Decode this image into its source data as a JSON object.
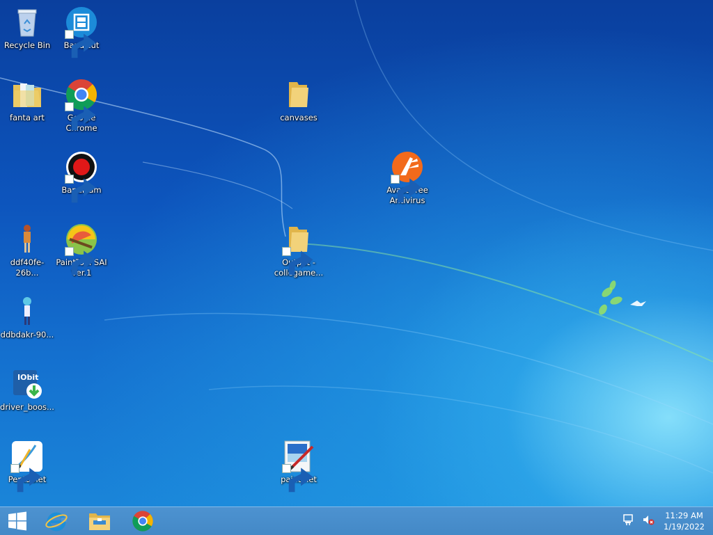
{
  "desktop": {
    "icons": [
      {
        "label": "Recycle Bin",
        "icon": "recycle-bin-icon",
        "shortcut": false
      },
      {
        "label": "Bandicut",
        "icon": "bandicut-icon",
        "shortcut": true
      },
      {
        "label": "fanta art",
        "icon": "folder-icon",
        "shortcut": false
      },
      {
        "label": "Google Chrome",
        "icon": "chrome-icon",
        "shortcut": true
      },
      {
        "label": "canvases",
        "icon": "folder-icon",
        "shortcut": false
      },
      {
        "label": "Bandicam",
        "icon": "bandicam-icon",
        "shortcut": true
      },
      {
        "label": "Avast Free Antivirus",
        "icon": "avast-icon",
        "shortcut": true
      },
      {
        "label": "ddf40fe-26b...",
        "icon": "image-file-icon",
        "shortcut": false
      },
      {
        "label": "PaintTool SAI Ver.1",
        "icon": "painttool-sai-icon",
        "shortcut": true
      },
      {
        "label": "Output - collegame...",
        "icon": "folder-icon",
        "shortcut": true
      },
      {
        "label": "ddbdakr-90...",
        "icon": "image-file-icon",
        "shortcut": false
      },
      {
        "label": "driver_boos...",
        "icon": "iobit-driver-booster-icon",
        "shortcut": false
      },
      {
        "label": "Pentablet",
        "icon": "pentablet-icon",
        "shortcut": true
      },
      {
        "label": "paint.net",
        "icon": "paintnet-icon",
        "shortcut": true
      }
    ]
  },
  "taskbar": {
    "start_icon": "windows-logo-icon",
    "pinned": [
      {
        "name": "Internet Explorer",
        "icon": "internet-explorer-icon"
      },
      {
        "name": "File Explorer",
        "icon": "file-explorer-icon"
      },
      {
        "name": "Google Chrome",
        "icon": "chrome-icon"
      }
    ],
    "tray": {
      "network_icon": "network-icon",
      "volume_icon": "volume-muted-icon",
      "time": "11:29 AM",
      "date": "1/19/2022"
    }
  }
}
